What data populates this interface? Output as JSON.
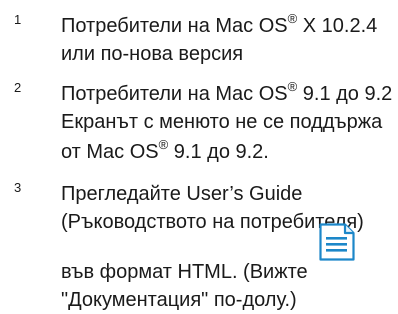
{
  "footnotes": [
    {
      "number": "1",
      "lines": [
        {
          "pre": "Потребители на Mac OS",
          "sup": "®",
          "post": " X 10.2.4"
        },
        {
          "pre": "или по-нова версия",
          "sup": "",
          "post": ""
        }
      ]
    },
    {
      "number": "2",
      "lines": [
        {
          "pre": "Потребители на Mac OS",
          "sup": "®",
          "post": " 9.1 до 9.2"
        },
        {
          "pre": "Екранът с менюто не се поддържа",
          "sup": "",
          "post": ""
        },
        {
          "pre": "от Mac OS",
          "sup": "®",
          "post": " 9.1 до 9.2."
        }
      ]
    },
    {
      "number": "3",
      "lines": [
        {
          "pre": "Прегледайте User’s Guide",
          "sup": "",
          "post": ""
        },
        {
          "pre": "(Ръководството на потребителя)",
          "sup": "",
          "post": ""
        },
        {
          "pre": "във формат HTML. (Вижте",
          "sup": "",
          "post": ""
        },
        {
          "pre": "\"Документация\" по-долу.)",
          "sup": "",
          "post": ""
        }
      ]
    }
  ],
  "icons": {
    "html_doc_icon": "document-icon",
    "icon_color": "#1c87c9"
  }
}
